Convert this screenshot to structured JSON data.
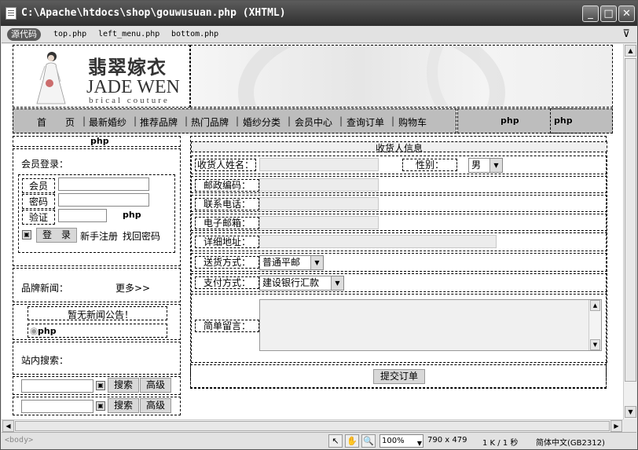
{
  "window": {
    "title": "C:\\Apache\\htdocs\\shop\\gouwusuan.php (XHTML)",
    "minimize": "_",
    "maximize": "□",
    "close": "✕"
  },
  "filebar": {
    "source_button": "源代码",
    "related_files": [
      "top.php",
      "left_menu.php",
      "bottom.php"
    ]
  },
  "header": {
    "brand_cn": "翡翠嫁衣",
    "brand_en": "JADE WEN",
    "brand_sub": "brical couture"
  },
  "nav": {
    "items": [
      "首　　页",
      "最新婚纱",
      "推荐品牌",
      "热门品牌",
      "婚纱分类",
      "会员中心",
      "查询订单",
      "购物车"
    ],
    "separator": "|",
    "php_tags": [
      "php",
      "php"
    ]
  },
  "left": {
    "top_php": "php",
    "member_login_title": "会员登录：",
    "member_label": "会员",
    "password_label": "密码",
    "verify_label": "验证",
    "verify_php": "php",
    "login_button": "登　录",
    "register_link": "新手注册",
    "recover_link": "找回密码",
    "brand_news_title": "品牌新闻：",
    "more_link": "更多>>",
    "no_news": "暂无新闻公告！",
    "news_php": "php",
    "site_search_title": "站内搜索：",
    "search_button": "搜索",
    "advanced_button": "高级"
  },
  "form": {
    "section_title": "收货人信息",
    "name_label": "收货人姓名：",
    "gender_label": "性别：",
    "gender_value": "男",
    "zip_label": "邮政编码：",
    "phone_label": "联系电话：",
    "email_label": "电子邮箱：",
    "address_label": "详细地址：",
    "delivery_label": "送货方式：",
    "delivery_value": "普通平邮",
    "payment_label": "支付方式：",
    "payment_value": "建设银行汇款",
    "note_label": "简单留言：",
    "submit_button": "提交订单"
  },
  "status": {
    "tag": "<body>",
    "zoom": "100%",
    "dimensions": "790 x 479",
    "size_time": "1 K / 1 秒",
    "encoding": "简体中文(GB2312)"
  }
}
